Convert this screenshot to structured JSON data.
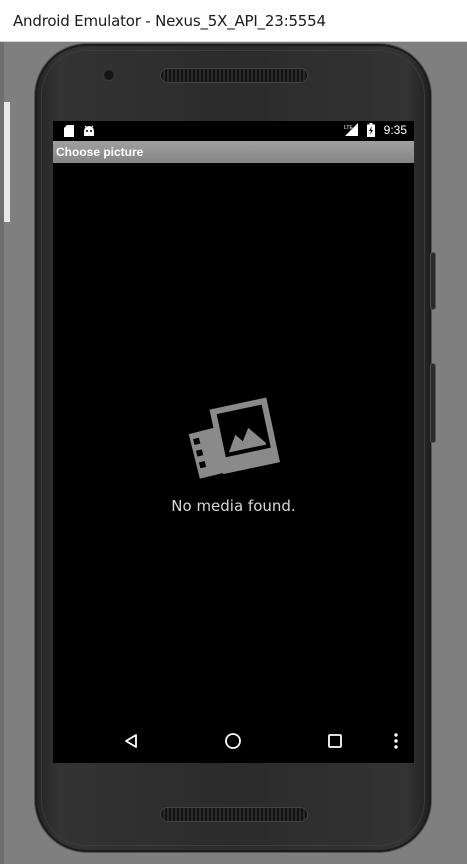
{
  "window": {
    "title": "Android Emulator - Nexus_5X_API_23:5554"
  },
  "status_bar": {
    "time": "9:35",
    "network": "LTE"
  },
  "app_bar": {
    "title": "Choose picture"
  },
  "empty_state": {
    "message": "No media found.",
    "icon": "photo-stack-icon"
  },
  "nav_bar": {
    "icons": [
      "back-icon",
      "home-icon",
      "recents-icon",
      "overflow-menu-icon"
    ]
  },
  "colors": {
    "appbar": "#9a9a9a",
    "screen": "#000000",
    "frame": "#2b2b2b"
  }
}
